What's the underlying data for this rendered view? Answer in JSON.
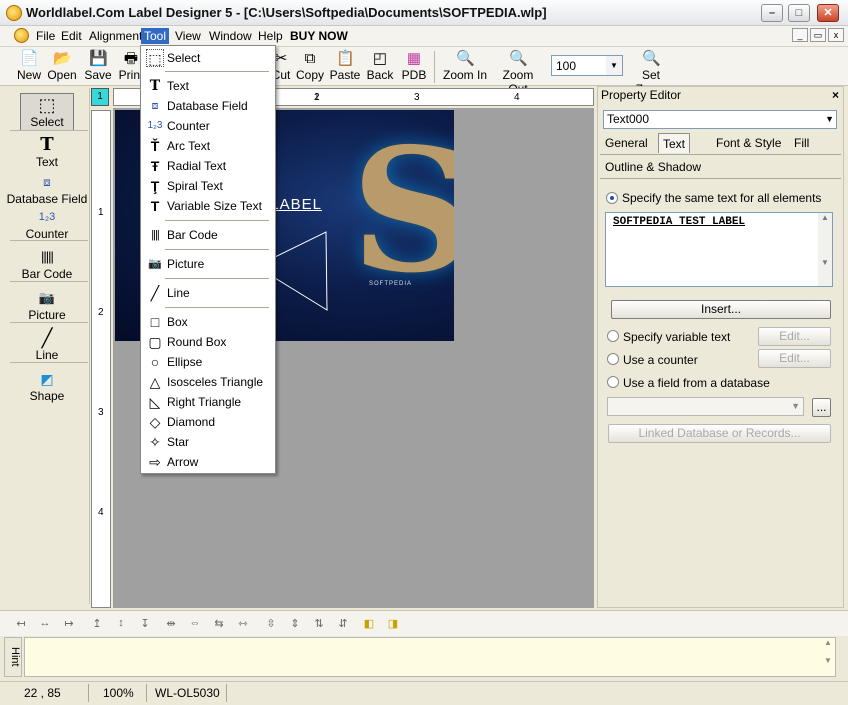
{
  "window": {
    "title": "Worldlabel.Com Label Designer 5  -  [C:\\Users\\Softpedia\\Documents\\SOFTPEDIA.wlp]",
    "minimize": "–",
    "maximize": "□",
    "close": "✕"
  },
  "menubar": {
    "items": [
      "File",
      "Edit",
      "Alignment",
      "Tool",
      "View",
      "Window",
      "Help",
      "BUY NOW"
    ],
    "mdi_min": "_",
    "mdi_restore": "▭",
    "mdi_close": "x"
  },
  "toolbar": {
    "new": "New",
    "open": "Open",
    "save": "Save",
    "print": "Print",
    "cut": "Cut",
    "copy": "Copy",
    "paste": "Paste",
    "back": "Back",
    "pdb": "PDB",
    "zoom_in": "Zoom In",
    "zoom_out": "Zoom Out",
    "zoom_value": "100",
    "set_zoom": "Set Zoom"
  },
  "palette": {
    "items": [
      "Select",
      "Text",
      "Database Field",
      "Counter",
      "Bar Code",
      "Picture",
      "Line",
      "Shape"
    ]
  },
  "ruler": {
    "corner": "1",
    "top_marks": [
      "1",
      "2",
      "3",
      "4"
    ],
    "left_marks": [
      "1",
      "2",
      "3",
      "4"
    ]
  },
  "label": {
    "text": "TEST LABEL",
    "big_letter": "S",
    "brand": "SOFTPEDIA"
  },
  "property_editor": {
    "title": "Property Editor",
    "close": "×",
    "object": "Text000",
    "tabs": [
      "General",
      "Text",
      "Font & Style",
      "Fill",
      "Outline & Shadow"
    ],
    "same_text_label": "Specify the same text for all elements",
    "text_value": "SOFTPEDIA TEST LABEL",
    "insert_button": "Insert...",
    "variable_text_label": "Specify variable text",
    "counter_label": "Use a counter",
    "database_field_label": "Use a field from a database",
    "edit_button": "Edit...",
    "browse_button": "...",
    "linked_db_button": "Linked Database or Records..."
  },
  "hint": {
    "tab": "Hint"
  },
  "status": {
    "coords": "22 , 85",
    "zoom": "100%",
    "template": "WL-OL5030"
  },
  "tool_menu": {
    "items": [
      "Select",
      "Text",
      "Database Field",
      "Counter",
      "Arc Text",
      "Radial Text",
      "Spiral Text",
      "Variable Size Text",
      "Bar Code",
      "Picture",
      "Line",
      "Box",
      "Round Box",
      "Ellipse",
      "Isosceles Triangle",
      "Right Triangle",
      "Diamond",
      "Star",
      "Arrow"
    ]
  },
  "icons": {
    "select": "select-icon",
    "text": "text-icon",
    "database_field": "database-field-icon",
    "counter": "counter-icon",
    "barcode": "barcode-icon",
    "picture": "camera-icon",
    "line": "line-icon",
    "shape": "shape-icon"
  },
  "colors": {
    "menu_highlight": "#316ac5",
    "ruler_corner": "#36d9d9",
    "hint_background": "#fffde1",
    "canvas_background": "#a0a0a0"
  }
}
